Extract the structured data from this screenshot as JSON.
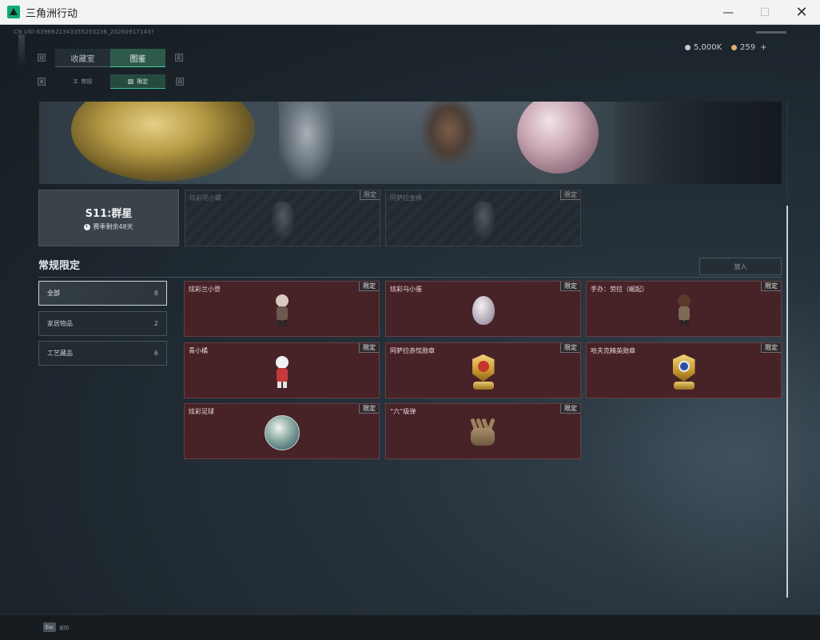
{
  "window": {
    "title": "三角洲行动"
  },
  "uid": "CN UID:6396621343355253236_20260917143?",
  "currency": {
    "silver": "5,000K",
    "gold": "259",
    "gold_plus": "+"
  },
  "tabs": {
    "left_key": "Q",
    "right_key": "E",
    "items": [
      "收藏室",
      "图鉴"
    ],
    "active": "图鉴"
  },
  "subtabs": {
    "left_key": "A",
    "right_key": "D",
    "items": [
      "常规",
      "限定"
    ],
    "active": "限定"
  },
  "season": {
    "title": "S11:群星",
    "remaining": "赛季剩余48天"
  },
  "locked_cards": [
    {
      "name": "炫彩花小螺",
      "tag": "限定"
    },
    {
      "name": "阿萨拉金佛",
      "tag": "限定"
    }
  ],
  "section": {
    "title": "常规限定",
    "put_button": "放入"
  },
  "filters": [
    {
      "label": "全部",
      "count": "8",
      "active": true
    },
    {
      "label": "家居物品",
      "count": "2",
      "active": false
    },
    {
      "label": "工艺藏品",
      "count": "6",
      "active": false
    }
  ],
  "items": [
    {
      "name": "炫彩兰小登",
      "tag": "限定",
      "icon": "doll-icon"
    },
    {
      "name": "炫彩乌小蛋",
      "tag": "限定",
      "icon": "egg-icon"
    },
    {
      "name": "手办：劳拉（崛起）",
      "tag": "限定",
      "icon": "figure-icon"
    },
    {
      "name": "青小橘",
      "tag": "限定",
      "icon": "figure-icon"
    },
    {
      "name": "阿萨拉赤忱勋章",
      "tag": "限定",
      "icon": "red-medal-icon"
    },
    {
      "name": "哈夫克精英勋章",
      "tag": "限定",
      "icon": "blue-medal-icon"
    },
    {
      "name": "炫彩足球",
      "tag": "限定",
      "icon": "football-icon"
    },
    {
      "name": "“六”级弹",
      "tag": "限定",
      "icon": "gauntlet-icon"
    }
  ],
  "footer": {
    "esc_key": "Esc",
    "esc_label": "返回"
  },
  "colors": {
    "accent": "#3dd29a",
    "item_bg": "#472227"
  }
}
